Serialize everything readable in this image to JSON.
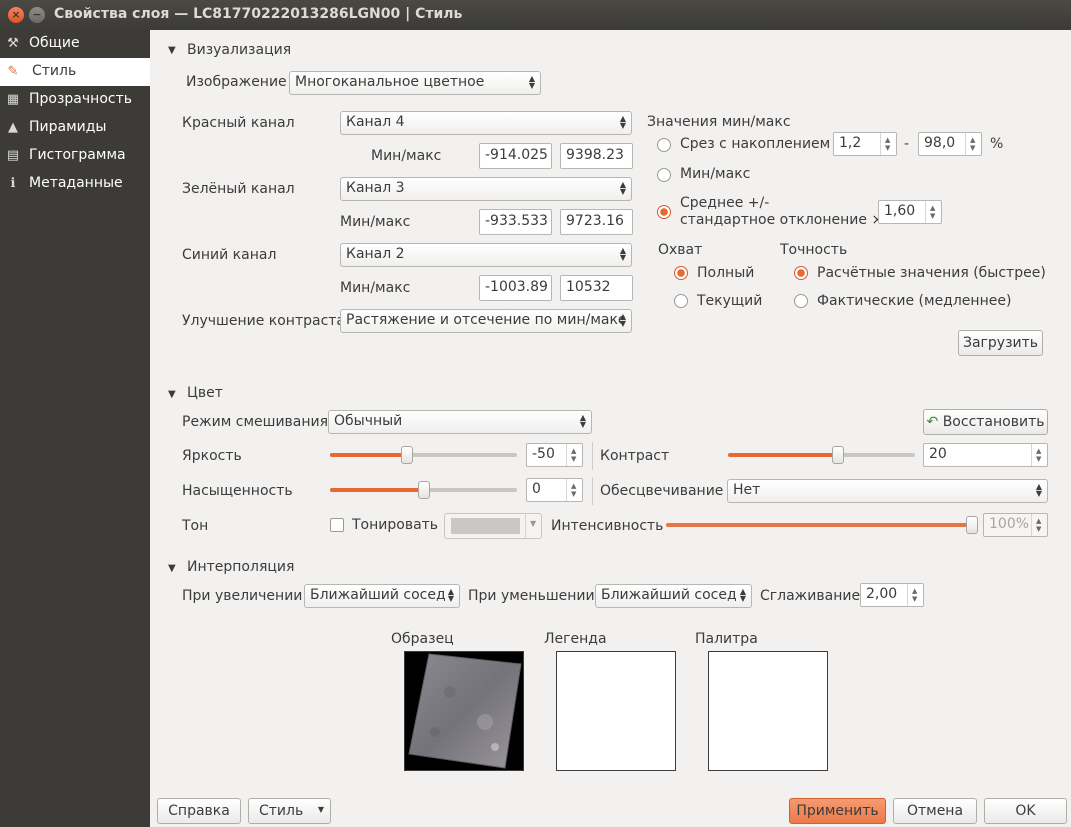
{
  "window": {
    "title": "Свойства слоя — LC81770222013286LGN00 | Стиль",
    "close_icon": "×",
    "minimize_icon": "−"
  },
  "sidebar": {
    "items": [
      {
        "label": "Общие",
        "icon": "tools-icon",
        "glyph": "⚒",
        "selected": false
      },
      {
        "label": "Стиль",
        "icon": "brush-icon",
        "glyph": "✎",
        "selected": true
      },
      {
        "label": "Прозрачность",
        "icon": "transparency-icon",
        "glyph": "▦",
        "selected": false
      },
      {
        "label": "Пирамиды",
        "icon": "pyramids-icon",
        "glyph": "▲",
        "selected": false
      },
      {
        "label": "Гистограмма",
        "icon": "histogram-icon",
        "glyph": "▤",
        "selected": false
      },
      {
        "label": "Метаданные",
        "icon": "info-icon",
        "glyph": "ℹ",
        "selected": false
      }
    ]
  },
  "render": {
    "section_title": "Визуализация",
    "renderer_label": "Изображение",
    "renderer_value": "Многоканальное цветное",
    "red": {
      "label": "Красный канал",
      "band": "Канал 4",
      "minmax_label": "Мин/макс",
      "min": "-914.025",
      "max": "9398.23"
    },
    "green": {
      "label": "Зелёный канал",
      "band": "Канал 3",
      "minmax_label": "Мин/макс",
      "min": "-933.533",
      "max": "9723.16"
    },
    "blue": {
      "label": "Синий канал",
      "band": "Канал 2",
      "minmax_label": "Мин/макс",
      "min": "-1003.89",
      "max": "10532"
    },
    "contrast_label": "Улучшение контраста",
    "contrast_value": "Растяжение и отсечение по мин/макс",
    "minmax": {
      "title": "Значения мин/макс",
      "cumulative_label": "Срез с накоплением",
      "cumulative_low": "1,2",
      "cumulative_sep": "-",
      "cumulative_high": "98,0",
      "percent": "%",
      "minmax_label": "Мин/макс",
      "stddev_label_1": "Среднее +/-",
      "stddev_label_2": "стандартное отклонение ×",
      "stddev_value": "1,60",
      "selected": "stddev",
      "extent_title": "Охват",
      "extent_full": "Полный",
      "extent_current": "Текущий",
      "accuracy_title": "Точность",
      "accuracy_estimate": "Расчётные значения (быстрее)",
      "accuracy_actual": "Фактические (медленнее)",
      "load_button": "Загрузить"
    }
  },
  "color": {
    "section_title": "Цвет",
    "blend_label": "Режим смешивания",
    "blend_value": "Обычный",
    "reset_button": "Восстановить",
    "brightness_label": "Яркость",
    "brightness_value": "-50",
    "brightness_level": 0.41,
    "contrast_label": "Контраст",
    "contrast_value": "20",
    "contrast_level": 0.59,
    "saturation_label": "Насыщенность",
    "saturation_value": "0",
    "saturation_level": 0.5,
    "grayscale_label": "Обесцвечивание",
    "grayscale_value": "Нет",
    "hue_label": "Тон",
    "colorize_label": "Тонировать",
    "intensity_label": "Интенсивность",
    "intensity_value": "100%",
    "intensity_level": 1.0
  },
  "resampling": {
    "section_title": "Интерполяция",
    "zoomed_in_label": "При увеличении",
    "zoomed_in_value": "Ближайший сосед",
    "zoomed_out_label": "При уменьшении",
    "zoomed_out_value": "Ближайший сосед",
    "oversampling_label": "Сглаживание",
    "oversampling_value": "2,00"
  },
  "previews": {
    "sample_label": "Образец",
    "legend_label": "Легенда",
    "palette_label": "Палитра"
  },
  "footer": {
    "help": "Справка",
    "style": "Стиль",
    "apply": "Применить",
    "cancel": "Отмена",
    "ok": "OK"
  },
  "colors": {
    "accent": "#e9682f",
    "sidebar_bg": "#3c3b37",
    "window_bg": "#f2f1f0"
  }
}
